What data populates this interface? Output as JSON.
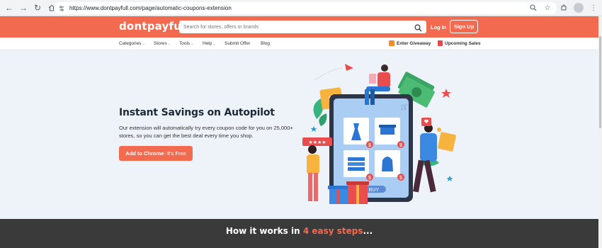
{
  "browser": {
    "url": "https://www.dontpayfull.com/page/automatic-coupons-extension"
  },
  "header": {
    "logo": "dontpayfull",
    "search_placeholder": "Search for stores, offers or brands",
    "login_label": "Log In",
    "signup_label": "Sign Up"
  },
  "subnav": {
    "items": [
      {
        "label": "Categories",
        "dropdown": true
      },
      {
        "label": "Stores",
        "dropdown": true
      },
      {
        "label": "Tools",
        "dropdown": true
      },
      {
        "label": "Help",
        "dropdown": true
      },
      {
        "label": "Submit Offer",
        "dropdown": false
      },
      {
        "label": "Blog",
        "dropdown": false
      }
    ],
    "giveaway_label": "Enter Giveaway",
    "sales_label": "Upcoming Sales"
  },
  "hero": {
    "title": "Instant Savings on Autopilot",
    "description": "Our extension will automatically try every coupon code for you on 25,000+ stores, so you can get the best deal every time you shop.",
    "cta_main": "Add to Chrome",
    "cta_sub": " - It's Free",
    "illustration": {
      "buy_label": "BUY",
      "dollar_sign": "$"
    }
  },
  "how": {
    "title_prefix": "How it works in ",
    "title_accent": "4 easy steps",
    "title_suffix": "..."
  },
  "colors": {
    "brand": "#f26b50",
    "hero_bg": "#eef2f9",
    "dark_section": "#3a3a3a"
  }
}
